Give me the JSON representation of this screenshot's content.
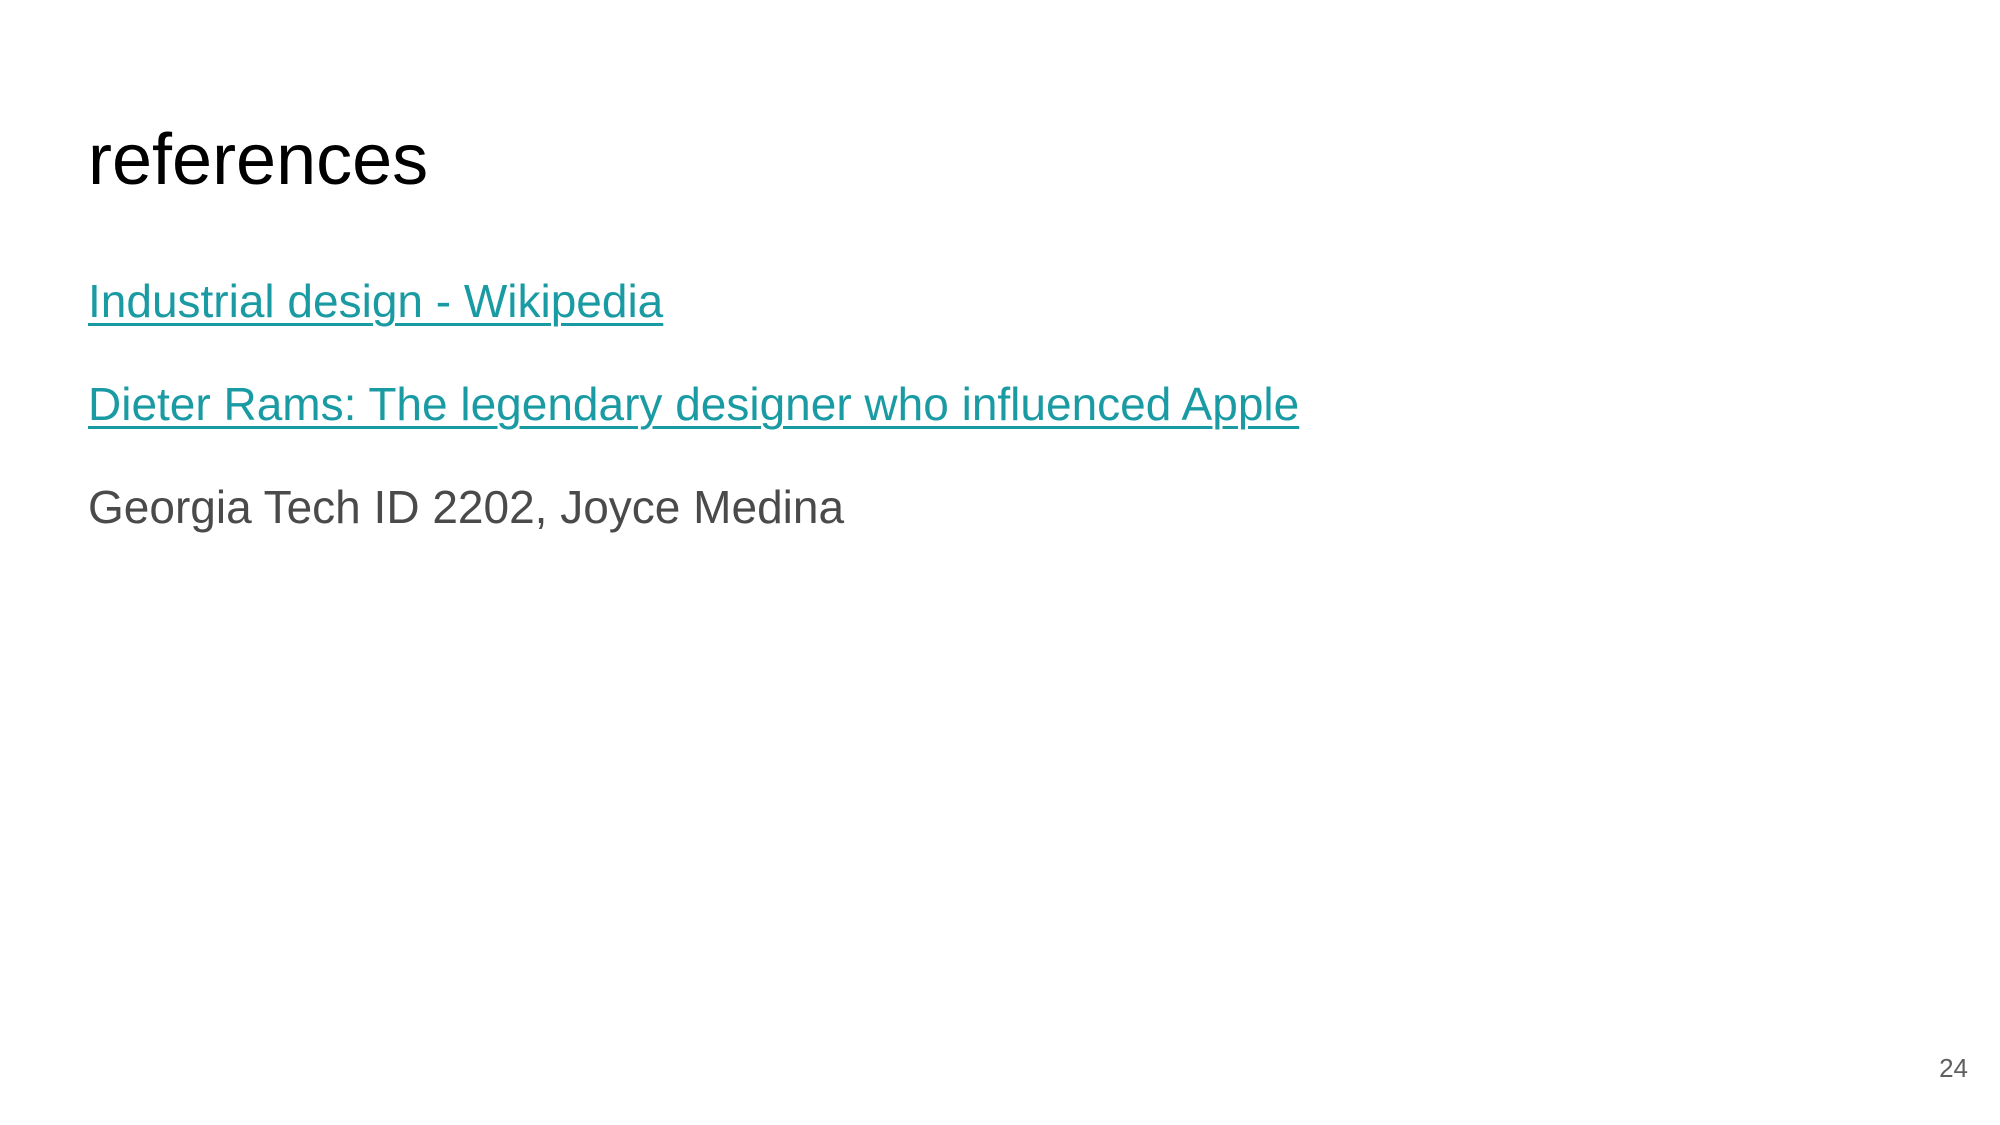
{
  "slide": {
    "title": "references",
    "references": [
      {
        "text": "Industrial design - Wikipedia",
        "is_link": true
      },
      {
        "text": "Dieter Rams: The legendary designer who influenced Apple",
        "is_link": true
      },
      {
        "text": "Georgia Tech ID 2202, Joyce Medina",
        "is_link": false
      }
    ],
    "page_number": "24"
  },
  "colors": {
    "link": "#1a9ba3",
    "body_text": "#4a4a4a",
    "title": "#000000",
    "page_number": "#5f5f5f",
    "background": "#ffffff"
  }
}
